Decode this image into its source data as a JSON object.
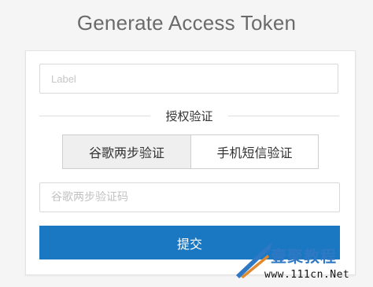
{
  "page": {
    "title": "Generate Access Token"
  },
  "form": {
    "label_placeholder": "Label",
    "section_heading": "授权验证",
    "tabs": [
      {
        "label": "谷歌两步验证",
        "active": true
      },
      {
        "label": "手机短信验证",
        "active": false
      }
    ],
    "code_placeholder": "谷歌两步验证码",
    "submit_label": "提交"
  },
  "watermark": {
    "brand": "壹聚教程",
    "url": "www.111cn.Net"
  },
  "colors": {
    "background": "#f5f5f5",
    "primary": "#1a78c2",
    "active_tab": "#efefef",
    "watermark_blue": "#2f78c4",
    "watermark_orange": "#e0892f"
  }
}
